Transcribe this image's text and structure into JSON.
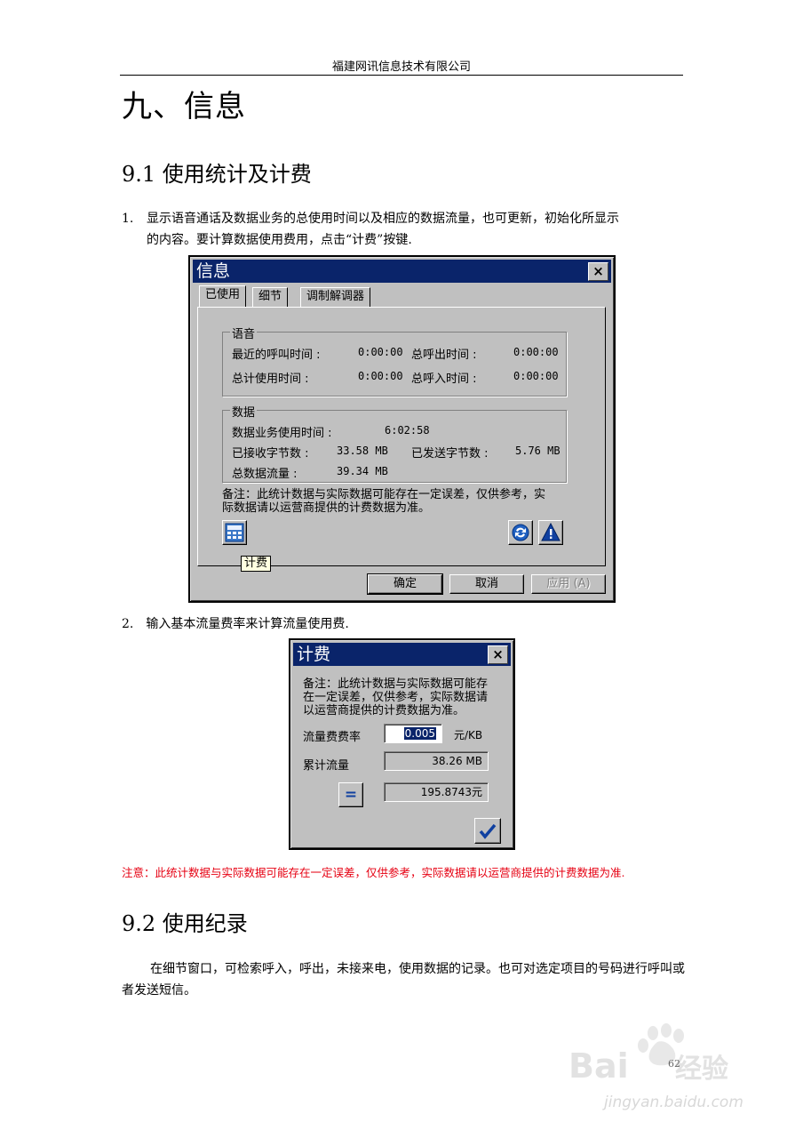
{
  "header": {
    "company": "福建网讯信息技术有限公司"
  },
  "chapter": {
    "title": "九、信息"
  },
  "section1": {
    "title": "9.1 使用统计及计费",
    "item1_num": "1.",
    "item1_line1": "显示语音通话及数据业务的总使用时间以及相应的数据流量，也可更新，初始化所显示",
    "item1_line2": "的内容。要计算数据使用费用，点击“计费”按键.",
    "item2_num": "2.",
    "item2_text": "输入基本流量费率来计算流量使用费.",
    "note": "注意：此统计数据与实际数据可能存在一定误差，仅供参考，实际数据请以运营商提供的计费数据为准."
  },
  "info_dialog": {
    "title": "信息",
    "close": "×",
    "tabs": [
      "已使用",
      "细节",
      "调制解调器"
    ],
    "voice_group": "语音",
    "recent_call_label": "最近的呼叫时间 :",
    "recent_call_value": "0:00:00",
    "total_out_label": "总呼出时间 :",
    "total_out_value": "0:00:00",
    "total_use_label": "总计使用时间 :",
    "total_use_value": "0:00:00",
    "total_in_label": "总呼入时间 :",
    "total_in_value": "0:00:00",
    "data_group": "数据",
    "data_time_label": "数据业务使用时间 :",
    "data_time_value": "6:02:58",
    "recv_label": "已接收字节数 :",
    "recv_value": "33.58 MB",
    "sent_label": "已发送字节数 :",
    "sent_value": "5.76 MB",
    "total_flow_label": "总数据流量 :",
    "total_flow_value": "39.34 MB",
    "remark_line1": "备注：此统计数据与实际数据可能存在一定误差，仅供参考，实",
    "remark_line2": "际数据请以运营商提供的计费数据为准。",
    "billing_tooltip": "计费",
    "ok": "确定",
    "cancel": "取消",
    "apply": "应用 (A)"
  },
  "billing_dialog": {
    "title": "计费",
    "close": "×",
    "remark_line1": "备注：此统计数据与实际数据可能存",
    "remark_line2": "在一定误差，仅供参考，实际数据请",
    "remark_line3": "以运营商提供的计费数据为准。",
    "rate_label": "流量费费率",
    "rate_value": "0.005",
    "rate_unit": "元/KB",
    "flow_label": "累计流量",
    "flow_value": "38.26 MB",
    "cost_value": "195.8743元",
    "equals": "="
  },
  "section2": {
    "title": "9.2 使用纪录",
    "body": "在细节窗口，可检索呼入，呼出，未接来电，使用数据的记录。也可对选定项目的号码进行呼叫或者发送短信。"
  },
  "footer": {
    "page_number": "62",
    "watermark": "jingyan.baidu.com"
  },
  "colors": {
    "note_red": "#e60012",
    "titlebar": "#0a246a",
    "dialog_face": "#c0c0c0"
  }
}
